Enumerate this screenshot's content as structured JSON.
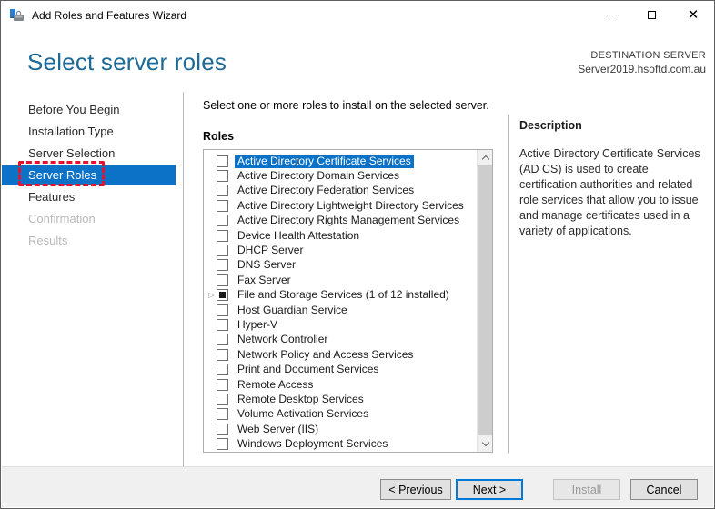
{
  "window": {
    "title": "Add Roles and Features Wizard",
    "controls": {
      "minimize": "minimize",
      "maximize": "maximize",
      "close": "close"
    }
  },
  "header": {
    "title": "Select server roles",
    "destination_label": "DESTINATION SERVER",
    "destination_server": "Server2019.hsoftd.com.au"
  },
  "sidebar": {
    "items": [
      {
        "label": "Before You Begin",
        "state": "normal"
      },
      {
        "label": "Installation Type",
        "state": "normal"
      },
      {
        "label": "Server Selection",
        "state": "normal"
      },
      {
        "label": "Server Roles",
        "state": "selected",
        "annotated": true
      },
      {
        "label": "Features",
        "state": "normal"
      },
      {
        "label": "Confirmation",
        "state": "disabled"
      },
      {
        "label": "Results",
        "state": "disabled"
      }
    ]
  },
  "main": {
    "instruction": "Select one or more roles to install on the selected server.",
    "roles_label": "Roles",
    "roles": [
      {
        "label": "Active Directory Certificate Services",
        "checked": "unchecked",
        "selected": true,
        "expandable": false
      },
      {
        "label": "Active Directory Domain Services",
        "checked": "unchecked",
        "selected": false,
        "expandable": false
      },
      {
        "label": "Active Directory Federation Services",
        "checked": "unchecked",
        "selected": false,
        "expandable": false
      },
      {
        "label": "Active Directory Lightweight Directory Services",
        "checked": "unchecked",
        "selected": false,
        "expandable": false
      },
      {
        "label": "Active Directory Rights Management Services",
        "checked": "unchecked",
        "selected": false,
        "expandable": false
      },
      {
        "label": "Device Health Attestation",
        "checked": "unchecked",
        "selected": false,
        "expandable": false
      },
      {
        "label": "DHCP Server",
        "checked": "unchecked",
        "selected": false,
        "expandable": false
      },
      {
        "label": "DNS Server",
        "checked": "unchecked",
        "selected": false,
        "expandable": false
      },
      {
        "label": "Fax Server",
        "checked": "unchecked",
        "selected": false,
        "expandable": false
      },
      {
        "label": "File and Storage Services (1 of 12 installed)",
        "checked": "mixed",
        "selected": false,
        "expandable": true
      },
      {
        "label": "Host Guardian Service",
        "checked": "unchecked",
        "selected": false,
        "expandable": false
      },
      {
        "label": "Hyper-V",
        "checked": "unchecked",
        "selected": false,
        "expandable": false
      },
      {
        "label": "Network Controller",
        "checked": "unchecked",
        "selected": false,
        "expandable": false
      },
      {
        "label": "Network Policy and Access Services",
        "checked": "unchecked",
        "selected": false,
        "expandable": false
      },
      {
        "label": "Print and Document Services",
        "checked": "unchecked",
        "selected": false,
        "expandable": false
      },
      {
        "label": "Remote Access",
        "checked": "unchecked",
        "selected": false,
        "expandable": false
      },
      {
        "label": "Remote Desktop Services",
        "checked": "unchecked",
        "selected": false,
        "expandable": false
      },
      {
        "label": "Volume Activation Services",
        "checked": "unchecked",
        "selected": false,
        "expandable": false
      },
      {
        "label": "Web Server (IIS)",
        "checked": "unchecked",
        "selected": false,
        "expandable": false
      },
      {
        "label": "Windows Deployment Services",
        "checked": "unchecked",
        "selected": false,
        "expandable": false
      }
    ]
  },
  "description": {
    "title": "Description",
    "text": "Active Directory Certificate Services (AD CS) is used to create certification authorities and related role services that allow you to issue and manage certificates used in a variety of applications."
  },
  "footer": {
    "previous_label": "< Previous",
    "next_label": "Next >",
    "install_label": "Install",
    "cancel_label": "Cancel"
  },
  "colors": {
    "accent_blue": "#0c72c7",
    "heading_blue": "#1d6a96",
    "annotation_red": "#e8112d",
    "footer_bg": "#f0f0f0",
    "disabled_text": "#b9b9b9"
  }
}
